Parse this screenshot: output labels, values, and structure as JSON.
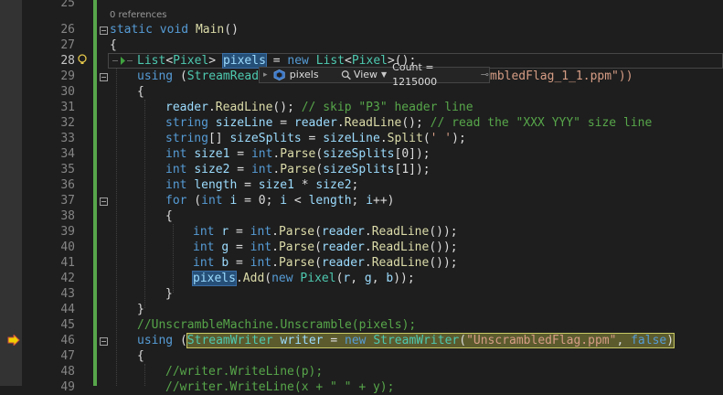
{
  "editor": {
    "code_lens": "0 references",
    "lines": [
      {
        "n": "25"
      },
      {
        "n": "26"
      },
      {
        "n": "27"
      },
      {
        "n": "28"
      },
      {
        "n": "29"
      },
      {
        "n": "30"
      },
      {
        "n": "31"
      },
      {
        "n": "32"
      },
      {
        "n": "33"
      },
      {
        "n": "34"
      },
      {
        "n": "35"
      },
      {
        "n": "36"
      },
      {
        "n": "37"
      },
      {
        "n": "38"
      },
      {
        "n": "39"
      },
      {
        "n": "40"
      },
      {
        "n": "41"
      },
      {
        "n": "42"
      },
      {
        "n": "43"
      },
      {
        "n": "44"
      },
      {
        "n": "45"
      },
      {
        "n": "46"
      },
      {
        "n": "47"
      },
      {
        "n": "48"
      },
      {
        "n": "49"
      }
    ]
  },
  "tokens": {
    "l26": {
      "kw1": "static",
      "kw2": "void",
      "fn": "Main",
      "rest": "()"
    },
    "l27": {
      "t": "{"
    },
    "l28": {
      "ty1": "List",
      "p1": "<",
      "ty2": "Pixel",
      "p2": ">",
      "id": "pixels",
      "p3": " = ",
      "kw": "new",
      "ty3": "List",
      "p4": "<",
      "ty4": "Pixel",
      "p5": ">();"
    },
    "l29": {
      "kw": "using",
      "p1": " (",
      "ty": "StreamRead",
      "tail": "mbledFlag_1_1.ppm\"))"
    },
    "l30": {
      "t": "{"
    },
    "l31": {
      "id": "reader",
      "p1": ".",
      "fn": "ReadLine",
      "p2": "(); ",
      "cm": "// skip \"P3\" header line"
    },
    "l32": {
      "kw": "string",
      "id1": "sizeLine",
      "p1": " = ",
      "id2": "reader",
      "p2": ".",
      "fn": "ReadLine",
      "p3": "(); ",
      "cm": "// read the \"XXX YYY\" size line"
    },
    "l33": {
      "kw": "string",
      "p0": "[] ",
      "id1": "sizeSplits",
      "p1": " = ",
      "id2": "sizeLine",
      "p2": ".",
      "fn": "Split",
      "p3": "(",
      "str": "' '",
      "p4": ");"
    },
    "l34": {
      "kw1": "int",
      "id1": "size1",
      "p1": " = ",
      "kw2": "int",
      "p2": ".",
      "fn": "Parse",
      "p3": "(",
      "id2": "sizeSplits",
      "p4": "[0]);"
    },
    "l35": {
      "kw1": "int",
      "id1": "size2",
      "p1": " = ",
      "kw2": "int",
      "p2": ".",
      "fn": "Parse",
      "p3": "(",
      "id2": "sizeSplits",
      "p4": "[1]);"
    },
    "l36": {
      "kw": "int",
      "id1": "length",
      "p1": " = ",
      "id2": "size1",
      "p2": " * ",
      "id3": "size2",
      "p3": ";"
    },
    "l37": {
      "kw1": "for",
      "p1": " (",
      "kw2": "int",
      "id1": "i",
      "p2": " = 0; ",
      "id2": "i",
      "p3": " < ",
      "id3": "length",
      "p4": "; ",
      "id4": "i",
      "p5": "++)"
    },
    "l38": {
      "t": "{"
    },
    "l39": {
      "kw1": "int",
      "v": "r",
      "p1": " = ",
      "kw2": "int",
      "p2": ".",
      "fn1": "Parse",
      "p3": "(",
      "id": "reader",
      "p4": ".",
      "fn2": "ReadLine",
      "p5": "());"
    },
    "l40": {
      "kw1": "int",
      "v": "g",
      "p1": " = ",
      "kw2": "int",
      "p2": ".",
      "fn1": "Parse",
      "p3": "(",
      "id": "reader",
      "p4": ".",
      "fn2": "ReadLine",
      "p5": "());"
    },
    "l41": {
      "kw1": "int",
      "v": "b",
      "p1": " = ",
      "kw2": "int",
      "p2": ".",
      "fn1": "Parse",
      "p3": "(",
      "id": "reader",
      "p4": ".",
      "fn2": "ReadLine",
      "p5": "());"
    },
    "l42": {
      "id": "pixels",
      "p1": ".",
      "fn": "Add",
      "p2": "(",
      "kw": "new",
      "ty": "Pixel",
      "p3": "(",
      "a": "r",
      "c1": ", ",
      "b2": "g",
      "c2": ", ",
      "c": "b",
      "p4": "));"
    },
    "l43": {
      "t": "}"
    },
    "l44": {
      "t": "}"
    },
    "l45": {
      "cm": "//UnscrambleMachine.Unscramble(pixels);"
    },
    "l46": {
      "kw": "using",
      "p1": " (",
      "ty1": "StreamWriter",
      "id": "writer",
      "p2": " = ",
      "kw2": "new",
      "ty2": "StreamWriter",
      "p3": "(",
      "str": "\"UnscrambledFlag.ppm\"",
      "p4": ", ",
      "kw3": "false",
      "p5": ")"
    },
    "l47": {
      "t": "{"
    },
    "l48": {
      "cm": "//writer.WriteLine(p);"
    },
    "l49": {
      "cm": "//writer.WriteLine(x + \" \" + y);"
    }
  },
  "datatip": {
    "name": "pixels",
    "view": "View",
    "count": "Count = 1215000"
  }
}
